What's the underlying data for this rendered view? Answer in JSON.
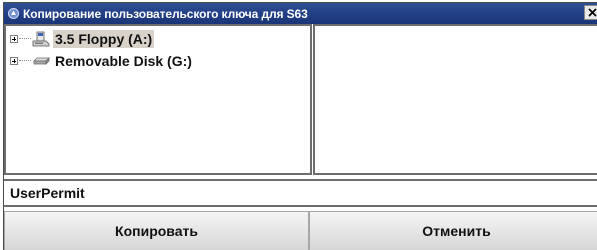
{
  "window": {
    "title": "Копирование пользовательского ключа для S63",
    "title_icon": "app-icon",
    "close_label": "x",
    "titlebar_color": "#223f85"
  },
  "tree": {
    "items": [
      {
        "label": "3.5 Floppy (A:)",
        "icon": "floppy-drive-icon",
        "selected": true
      },
      {
        "label": "Removable Disk (G:)",
        "icon": "removable-disk-icon",
        "selected": false
      }
    ],
    "selection_color": "#d8d2c8"
  },
  "filename": {
    "value": "UserPermit"
  },
  "buttons": {
    "copy_label": "Копировать",
    "cancel_label": "Отменить"
  }
}
